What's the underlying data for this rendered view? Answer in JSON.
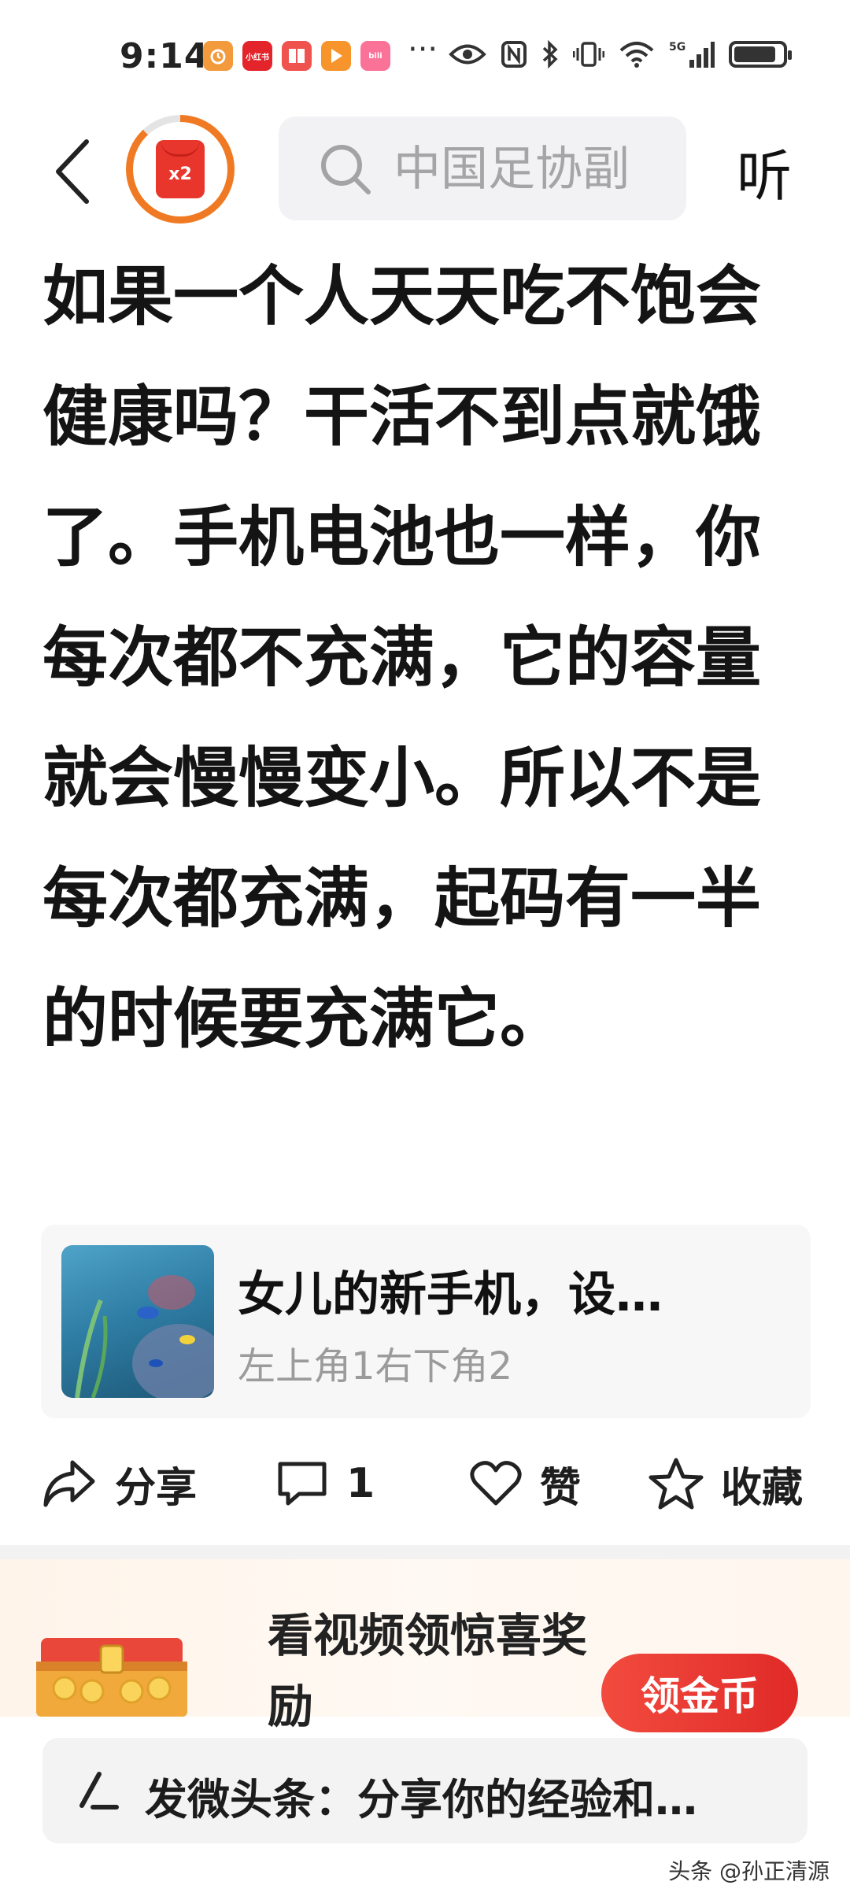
{
  "status_bar": {
    "time": "9:14",
    "overflow_indicator": "···",
    "battery_level": 0.9,
    "icons": [
      "alarm-icon",
      "xiaohongshu-icon",
      "reader-icon",
      "video-icon",
      "bilibili-icon",
      "eye-icon",
      "nfc-icon",
      "bluetooth-icon",
      "vibrate-icon",
      "wifi-icon",
      "signal-5g-icon",
      "battery-icon"
    ]
  },
  "header": {
    "search_placeholder": "中国足协副",
    "listen_label": "听",
    "reward_badge_text": "x2",
    "reward_progress": 0.88
  },
  "article": {
    "body": "如果一个人天天吃不饱会健康吗？干活不到点就饿了。手机电池也一样，你每次都不充满，它的容量就会慢慢变小。所以不是每次都充满，起码有一半的时候要充满它。"
  },
  "linked_card": {
    "title": "女儿的新手机，设…",
    "subtitle": "左上角1右下角2"
  },
  "actions": {
    "share_label": "分享",
    "comment_count": "1",
    "like_label": "赞",
    "collect_label": "收藏"
  },
  "promo": {
    "title": "看视频领惊喜奖励",
    "button_label": "领金币"
  },
  "composer": {
    "placeholder": "发微头条：分享你的经验和…"
  },
  "watermark": "头条 @孙正清源",
  "colors": {
    "accent_orange": "#f07a23",
    "reward_red": "#e8362c",
    "promo_button": "#e8362c",
    "muted_text": "#9b9b9b"
  }
}
